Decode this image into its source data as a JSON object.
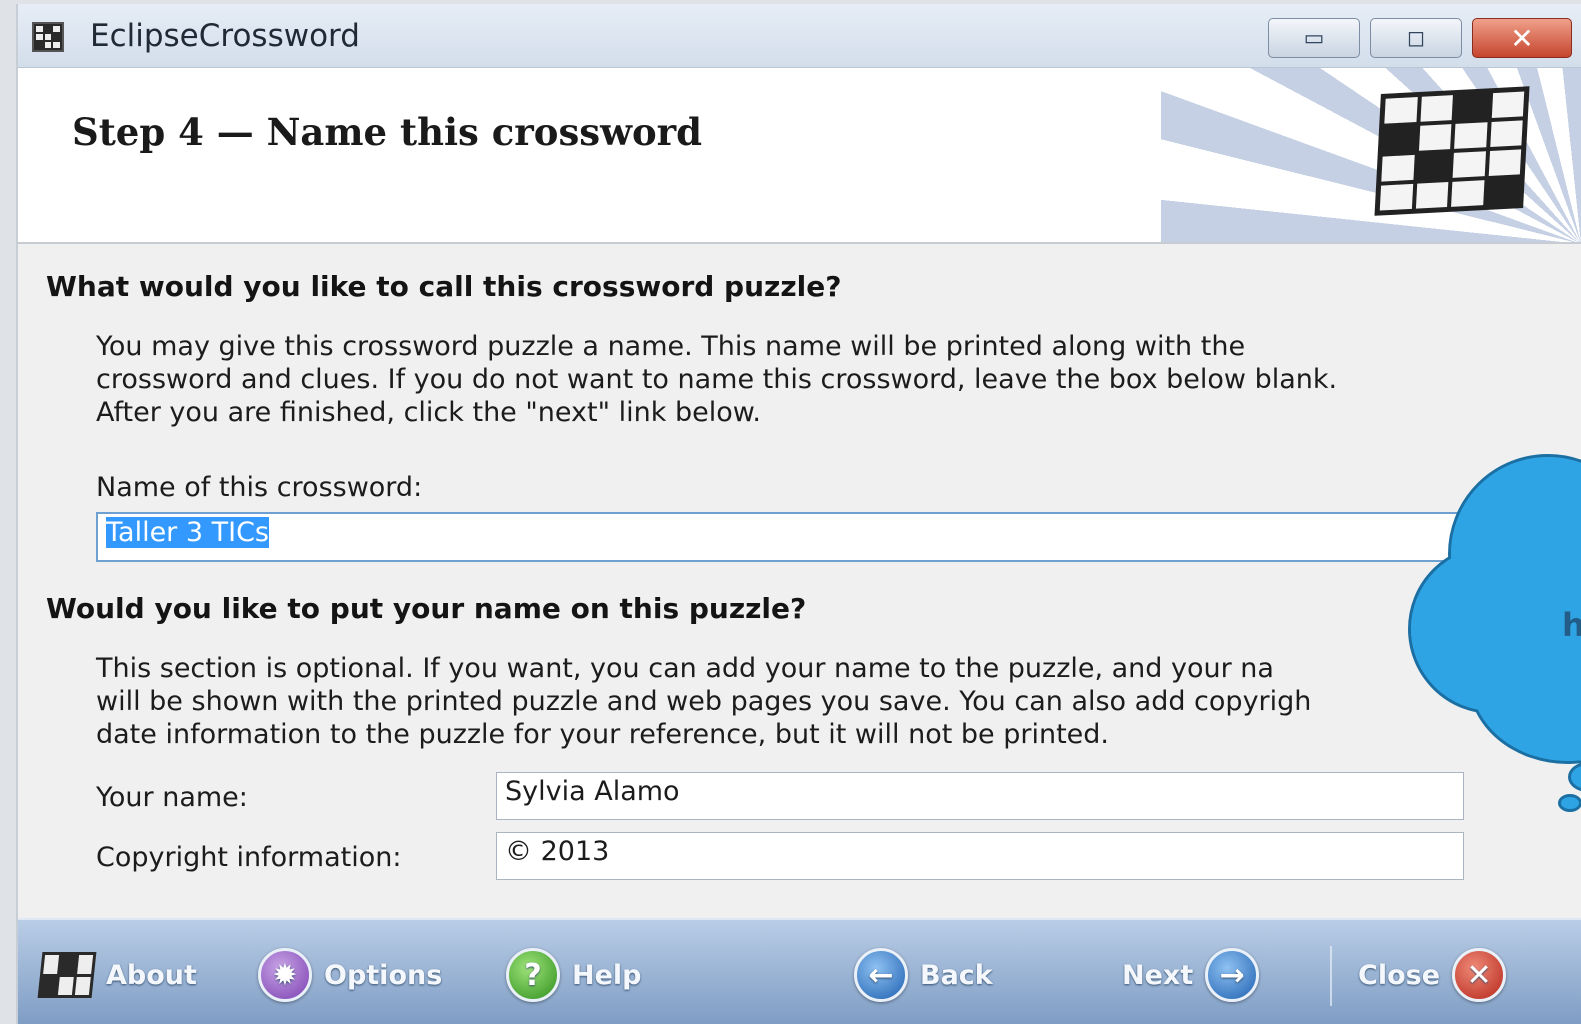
{
  "window": {
    "title": "EclipseCrossword",
    "controls": {
      "minimize": "▭",
      "maximize": "◻",
      "close": "✕"
    }
  },
  "header": {
    "step_title": "Step 4 — Name this crossword"
  },
  "section_name": {
    "heading": "What would you like to call this crossword puzzle?",
    "description": "You may give this crossword puzzle a name.  This name will be printed along with the\ncrossword and clues.  If you do not want to name this crossword, leave the box below blank.\n After you are finished, click the \"next\" link below.",
    "field_label": "Name of this crossword:",
    "field_value": "Taller 3 TICs"
  },
  "section_author": {
    "heading": "Would you like to put your name on this puzzle?",
    "description": "This section is optional.  If you want, you can add your name to the puzzle, and your na\nwill be shown with the printed puzzle and web pages you save.  You can also add copyrigh\ndate information to the puzzle for your reference, but it will not be printed.",
    "your_name_label": "Your name:",
    "your_name_value": "Sylvia Alamo",
    "copyright_label": "Copyright information:",
    "copyright_value": "© 2013"
  },
  "callout": {
    "text": "h",
    "color": "#2fa4e4"
  },
  "footer": {
    "about": "About",
    "options": "Options",
    "help": "Help",
    "back": "Back",
    "next": "Next",
    "close": "Close",
    "icons": {
      "options": "star-icon",
      "help": "question-icon",
      "back": "arrow-left-icon",
      "next": "arrow-right-icon",
      "close": "close-icon"
    }
  }
}
